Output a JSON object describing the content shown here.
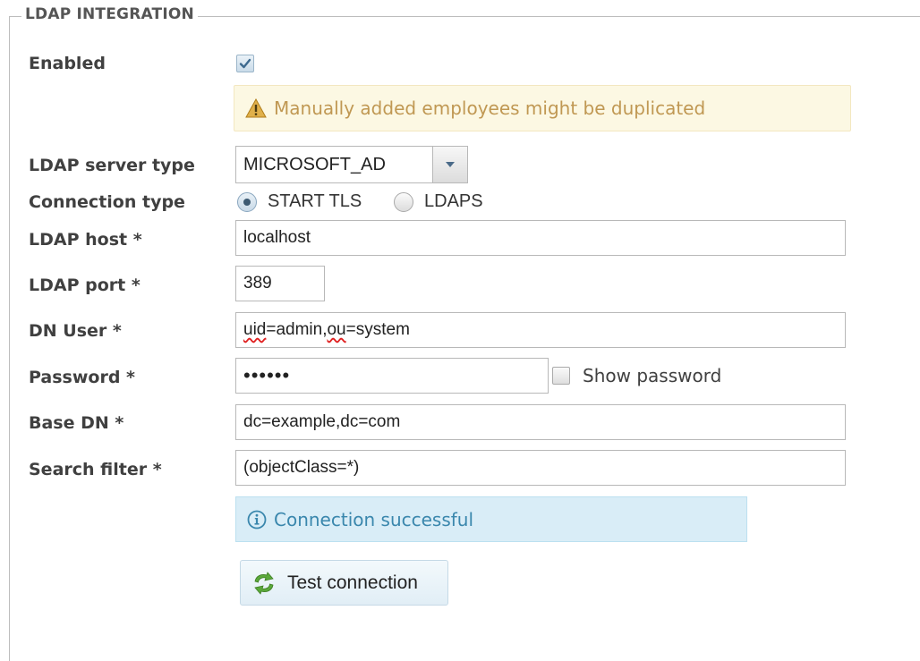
{
  "section": {
    "title": "LDAP INTEGRATION"
  },
  "enabled": {
    "label": "Enabled",
    "checked": true
  },
  "warning": {
    "icon": "warning-icon",
    "text": "Manually added employees might be duplicated",
    "color": "#c09853"
  },
  "server_type": {
    "label": "LDAP server type",
    "value": "MICROSOFT_AD"
  },
  "connection_type": {
    "label": "Connection type",
    "options": [
      {
        "label": "START TLS",
        "selected": true
      },
      {
        "label": "LDAPS",
        "selected": false
      }
    ]
  },
  "host": {
    "label": "LDAP host *",
    "value": "localhost"
  },
  "port": {
    "label": "LDAP port *",
    "value": "389"
  },
  "dn_user": {
    "label": "DN User *",
    "value_parts": [
      "uid",
      "=admin,",
      "ou",
      "=system"
    ]
  },
  "password": {
    "label": "Password *",
    "value": "••••••",
    "show_label": "Show password",
    "show_checked": false
  },
  "base_dn": {
    "label": "Base DN *",
    "value": "dc=example,dc=com"
  },
  "search_filter": {
    "label": "Search filter *",
    "value": "(objectClass=*)"
  },
  "status": {
    "icon": "info-icon",
    "text": "Connection successful",
    "color": "#3a87ad"
  },
  "test_button": {
    "icon": "refresh-icon",
    "label": "Test connection"
  }
}
